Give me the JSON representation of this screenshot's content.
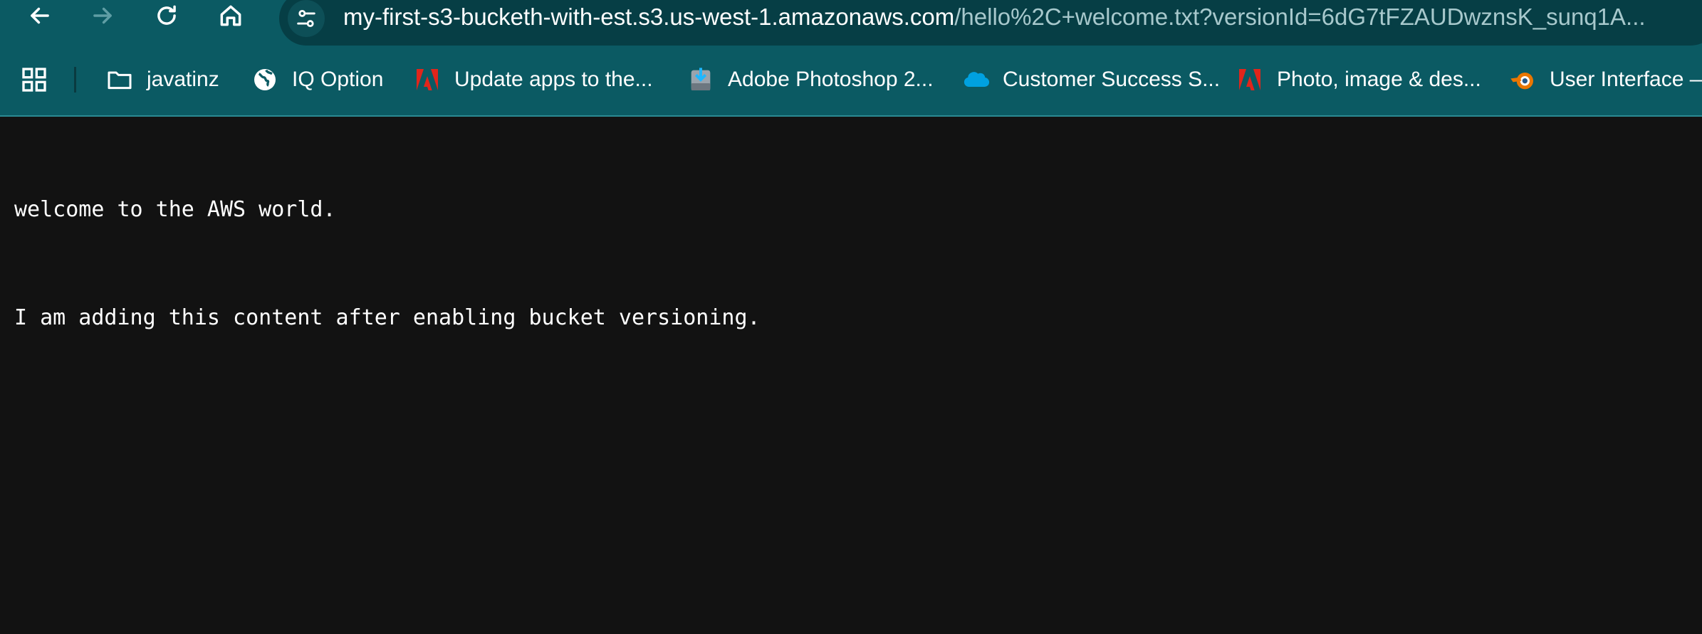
{
  "toolbar": {
    "back_icon": "arrow-left-icon",
    "forward_icon": "arrow-right-icon",
    "reload_icon": "reload-icon",
    "home_icon": "home-icon"
  },
  "address_bar": {
    "site_info_icon": "tune-icon",
    "host": "my-first-s3-bucketh-with-est.s3.us-west-1.amazonaws.com",
    "path": "/hello%2C+welcome.txt?versionId=6dG7tFZAUDwznsK_sunq1A..."
  },
  "bookmarks": [
    {
      "label": "javatinz",
      "icon": "folder-icon"
    },
    {
      "label": "IQ Option",
      "icon": "globe-icon"
    },
    {
      "label": "Update apps to the...",
      "icon": "adobe-icon"
    },
    {
      "label": "Adobe Photoshop 2...",
      "icon": "download-icon"
    },
    {
      "label": "Customer Success S...",
      "icon": "salesforce-cloud-icon"
    },
    {
      "label": "Photo, image & des...",
      "icon": "adobe-icon"
    },
    {
      "label": "User Interface —",
      "icon": "blender-icon"
    }
  ],
  "colors": {
    "toolbar": "#0b5a63",
    "omnibox": "#063e45",
    "page_background": "#121212",
    "adobe_red": "#e1251b",
    "salesforce_blue": "#00a1e0",
    "blender_orange": "#ea7600"
  },
  "document": {
    "lines": [
      "welcome to the AWS world.",
      "I am adding this content after enabling bucket versioning."
    ]
  }
}
